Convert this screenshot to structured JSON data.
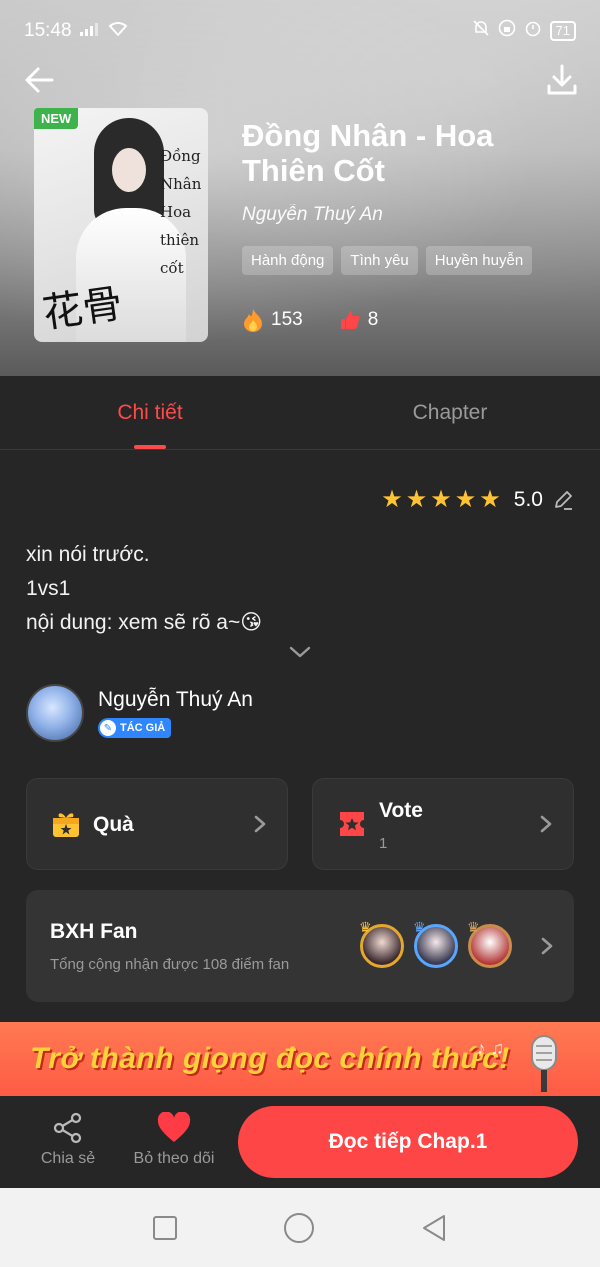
{
  "status_bar": {
    "time": "15:48",
    "battery": "71"
  },
  "book": {
    "badge": "NEW",
    "title": "Đồng Nhân - Hoa Thiên Cốt",
    "author": "Nguyễn Thuý An",
    "tags": [
      "Hành động",
      "Tình yêu",
      "Huyền huyễn"
    ],
    "views": "153",
    "likes": "8",
    "cover_text": "Đồng Nhân Hoa thiên cốt",
    "cover_brush": "花骨"
  },
  "tabs": [
    {
      "label": "Chi tiết",
      "active": true
    },
    {
      "label": "Chapter",
      "active": false
    }
  ],
  "rating": {
    "score": "5.0",
    "stars": 5
  },
  "description": [
    "xin nói trước.",
    "1vs1",
    "nội dung: xem sẽ rõ a~😘"
  ],
  "author_card": {
    "name": "Nguyễn Thuý An",
    "badge": "TÁC GIẢ"
  },
  "gift": {
    "label": "Quà"
  },
  "vote": {
    "label": "Vote",
    "count": "1"
  },
  "fan_rank": {
    "title": "BXH Fan",
    "subtitle": "Tổng cộng nhận được 108 điểm fan"
  },
  "banner": {
    "text": "Trở thành giọng đọc chính thức!"
  },
  "bottom": {
    "share": "Chia sẻ",
    "unfollow": "Bỏ theo dõi",
    "read": "Đọc tiếp Chap.1"
  },
  "colors": {
    "accent": "#ff4646",
    "star": "#ffc233",
    "background": "#262626",
    "new_badge": "#3eb34b"
  }
}
